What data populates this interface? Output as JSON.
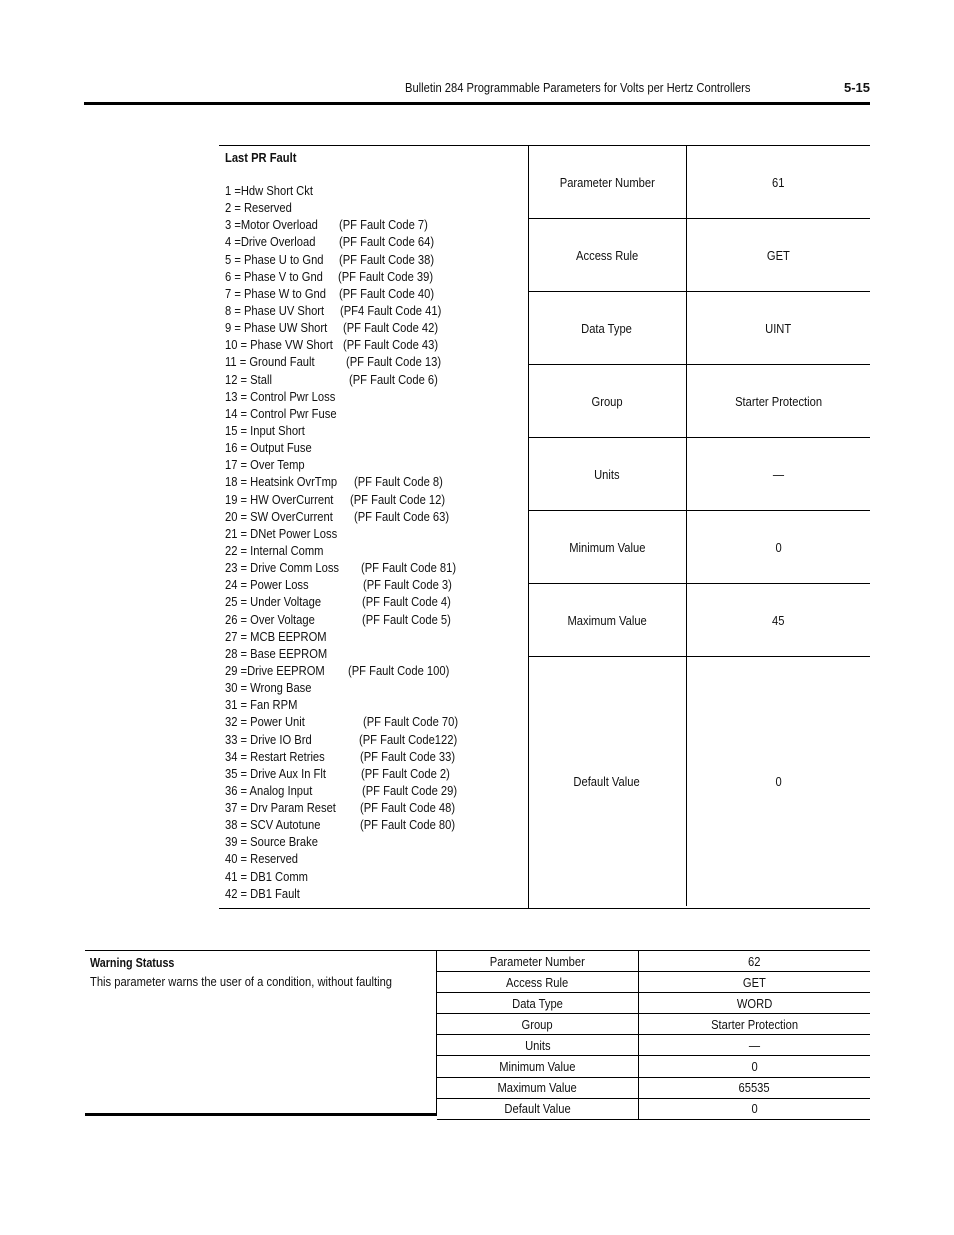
{
  "header": {
    "title": "Bulletin 284 Programmable Parameters for Volts per Hertz Controllers",
    "page_number": "5-15"
  },
  "last_pr_fault": {
    "title": "Last PR Fault",
    "faults": [
      {
        "name": "1 =Hdw Short Ckt",
        "code": ""
      },
      {
        "name": "2 = Reserved",
        "code": ""
      },
      {
        "name": "3 =Motor Overload",
        "code": "(PF Fault Code 7)"
      },
      {
        "name": "4 =Drive Overload",
        "code": "(PF Fault Code 64)"
      },
      {
        "name": "5 = Phase U to Gnd",
        "code": "(PF Fault Code 38)"
      },
      {
        "name": "6 = Phase V to Gnd",
        "code": "(PF Fault Code 39)"
      },
      {
        "name": "7 = Phase W to Gnd",
        "code": "(PF Fault Code 40)"
      },
      {
        "name": "8 = Phase UV Short",
        "code": "(PF4 Fault Code 41)"
      },
      {
        "name": "9 = Phase UW Short",
        "code": "(PF Fault Code 42)"
      },
      {
        "name": "10 = Phase VW Short",
        "code": "(PF Fault Code 43)"
      },
      {
        "name": "11 = Ground Fault",
        "code": "(PF Fault Code 13)"
      },
      {
        "name": "12 = Stall",
        "code": "(PF Fault Code 6)"
      },
      {
        "name": "13 = Control Pwr Loss",
        "code": ""
      },
      {
        "name": "14 = Control Pwr Fuse",
        "code": ""
      },
      {
        "name": "15 = Input Short",
        "code": ""
      },
      {
        "name": "16 = Output Fuse",
        "code": ""
      },
      {
        "name": "17 = Over Temp",
        "code": ""
      },
      {
        "name": "18 = Heatsink OvrTmp",
        "code": "(PF Fault Code 8)"
      },
      {
        "name": "19 = HW OverCurrent",
        "code": "(PF Fault Code 12)"
      },
      {
        "name": "20 = SW OverCurrent",
        "code": "(PF Fault Code 63)"
      },
      {
        "name": "21 = DNet Power Loss",
        "code": ""
      },
      {
        "name": "22 = Internal Comm",
        "code": ""
      },
      {
        "name": "23 = Drive Comm Loss",
        "code": "(PF Fault Code 81)"
      },
      {
        "name": "24 = Power Loss",
        "code": "(PF Fault Code 3)"
      },
      {
        "name": "25 = Under Voltage",
        "code": "(PF Fault Code 4)"
      },
      {
        "name": "26 = Over Voltage",
        "code": "(PF Fault Code 5)"
      },
      {
        "name": "27 = MCB EEPROM",
        "code": ""
      },
      {
        "name": "28 = Base EEPROM",
        "code": ""
      },
      {
        "name": "29 =Drive EEPROM",
        "code": "(PF Fault Code 100)"
      },
      {
        "name": "30 = Wrong Base",
        "code": ""
      },
      {
        "name": "31 = Fan RPM",
        "code": ""
      },
      {
        "name": "32 = Power Unit",
        "code": "(PF Fault Code 70)"
      },
      {
        "name": "33 = Drive IO Brd",
        "code": "(PF Fault Code122)"
      },
      {
        "name": "34 = Restart Retries",
        "code": "(PF Fault Code 33)"
      },
      {
        "name": "35 = Drive Aux In Flt",
        "code": "(PF Fault Code 2)"
      },
      {
        "name": "36 = Analog Input",
        "code": "(PF Fault Code 29)"
      },
      {
        "name": "37 = Drv Param Reset",
        "code": "(PF Fault Code 48)"
      },
      {
        "name": "38 = SCV Autotune",
        "code": "(PF Fault Code 80)"
      },
      {
        "name": "39 = Source Brake",
        "code": ""
      },
      {
        "name": "40 = Reserved",
        "code": ""
      },
      {
        "name": "41 = DB1 Comm",
        "code": ""
      },
      {
        "name": "42 = DB1 Fault",
        "code": ""
      }
    ],
    "properties": [
      {
        "label": "Parameter Number",
        "value": "61"
      },
      {
        "label": "Access Rule",
        "value": "GET"
      },
      {
        "label": "Data Type",
        "value": "UINT"
      },
      {
        "label": "Group",
        "value": "Starter Protection"
      },
      {
        "label": "Units",
        "value": "—"
      },
      {
        "label": "Minimum Value",
        "value": "0"
      },
      {
        "label": "Maximum Value",
        "value": "45"
      },
      {
        "label": "Default Value",
        "value": "0"
      }
    ]
  },
  "warning_status": {
    "title": "Warning Statuss",
    "description": "This parameter warns the user of a condition, without faulting",
    "properties": [
      {
        "label": "Parameter Number",
        "value": "62"
      },
      {
        "label": "Access Rule",
        "value": "GET"
      },
      {
        "label": "Data Type",
        "value": "WORD"
      },
      {
        "label": "Group",
        "value": "Starter Protection"
      },
      {
        "label": "Units",
        "value": "—"
      },
      {
        "label": "Minimum Value",
        "value": "0"
      },
      {
        "label": "Maximum Value",
        "value": "65535"
      },
      {
        "label": "Default Value",
        "value": "0"
      }
    ]
  }
}
